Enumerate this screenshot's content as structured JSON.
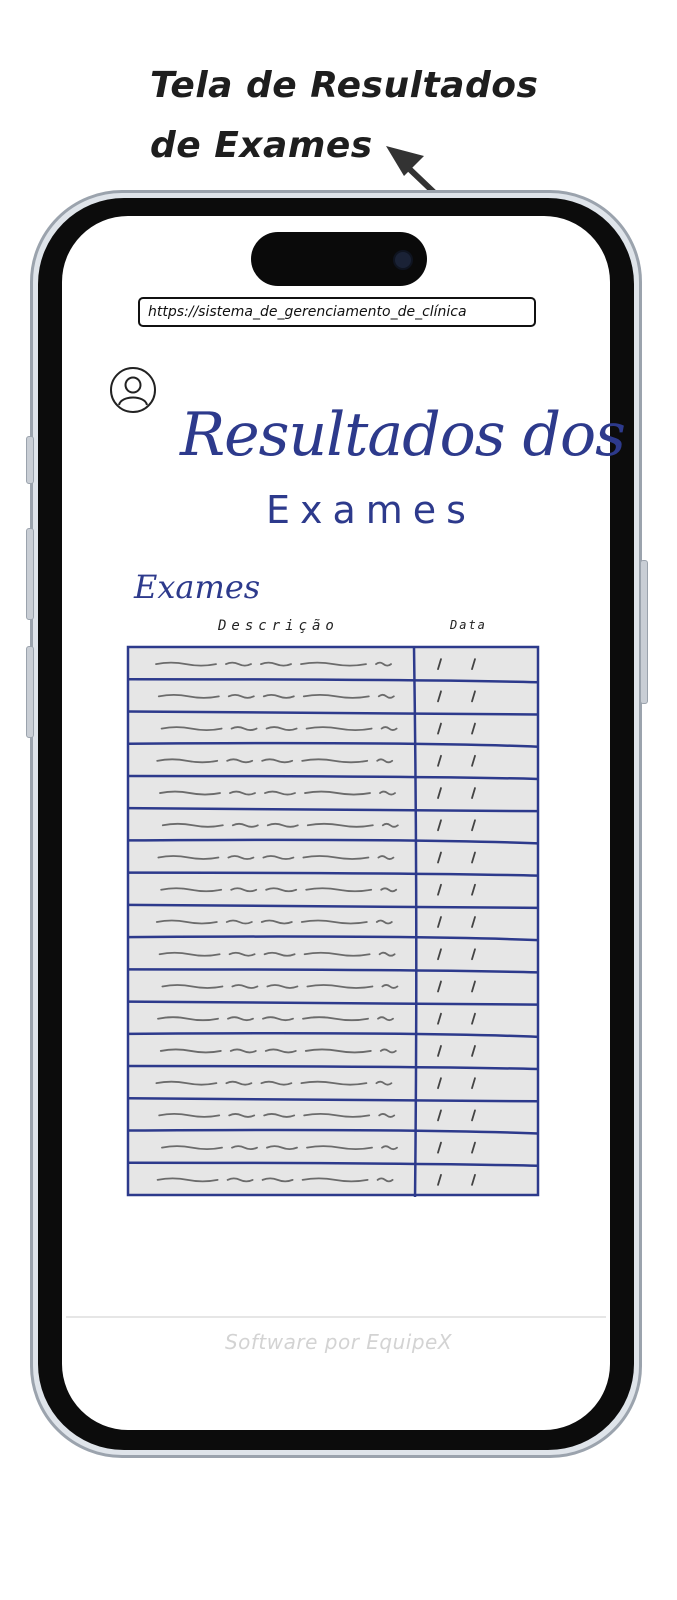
{
  "annotation": {
    "title": "Tela de Resultados de Exames"
  },
  "browser": {
    "url": "https://sistema_de_gerenciamento_de_clínica"
  },
  "header": {
    "avatar_icon": "user-avatar-icon",
    "title_line1": "Resultados dos",
    "title_line2": "Exames"
  },
  "exams": {
    "section_title": "Exames",
    "columns": {
      "description": "Descrição",
      "date": "Data"
    },
    "row_count": 17
  },
  "footer": {
    "text": "Software por EquipeX"
  },
  "colors": {
    "ink_blue": "#2d3a8c",
    "table_fill": "#e6e6e6",
    "scribble": "#6b6b6b"
  }
}
